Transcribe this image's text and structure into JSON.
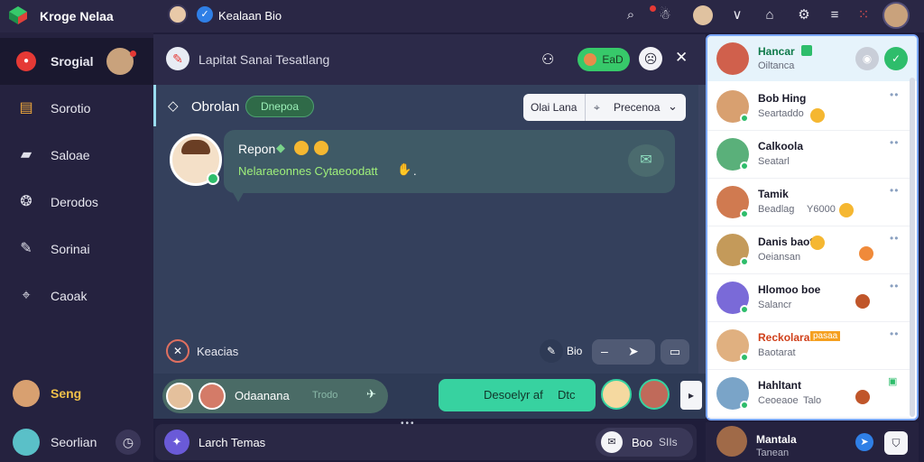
{
  "app": {
    "title": "Kroge Nelaa",
    "user": "Kealaan Bio"
  },
  "sidebar": {
    "items": [
      {
        "label": "Srogial",
        "icon": "record-icon"
      },
      {
        "label": "Sorotio",
        "icon": "clipboard-icon"
      },
      {
        "label": "Saloae",
        "icon": "folder-icon"
      },
      {
        "label": "Derodos",
        "icon": "chip-icon"
      },
      {
        "label": "Sorinai",
        "icon": "pencil-icon"
      },
      {
        "label": "Caoak",
        "icon": "pin-icon"
      }
    ],
    "profile_label": "Seng",
    "profile_sub": "Seorlian"
  },
  "chat": {
    "header_title": "Lapitat Sanai Tesatlang",
    "header_pill": "EaD",
    "channel": "Obrolan",
    "channel_badge": "Dnepoa",
    "dropdown_left": "Olai Lana",
    "dropdown_right": "Precenoa",
    "message_author": "Repon",
    "message_text": "Nelaraeonnes Cytaeoodatt",
    "message_tail": ".",
    "footer_action": "Keacias",
    "edit_label": "Bio",
    "compose_text": "Odaanana",
    "compose_hint": "Trodo",
    "send_button": "Desoelyr af",
    "send_tag": "Dtc",
    "input_placeholder": "Larch Temas",
    "input_right": "Boo",
    "input_right_sub": "SIIs"
  },
  "contacts": {
    "header_name": "Hancar",
    "header_status": "Oiltanca",
    "list": [
      {
        "name": "Bob Hing",
        "status": "Seartaddo"
      },
      {
        "name": "Calkoola",
        "status": "Seatarl"
      },
      {
        "name": "Tamik",
        "status": "Beadlag",
        "extra": "Y6000"
      },
      {
        "name": "Danis baot",
        "status": "Oeiansan"
      },
      {
        "name": "Hlomoo boe",
        "status": "Salancr"
      },
      {
        "name": "Reckolara",
        "status": "Baotarat",
        "tag": "pasaa"
      },
      {
        "name": "Hahltant",
        "status": "Ceoeaoe",
        "extra": "Talo"
      },
      {
        "name": "Mantala",
        "status": "Tanean"
      }
    ]
  },
  "colors": {
    "accent_green": "#37d28c",
    "accent_blue": "#2f7fe6",
    "bg": "#1f1d3a",
    "chat_bg": "#34405c"
  }
}
